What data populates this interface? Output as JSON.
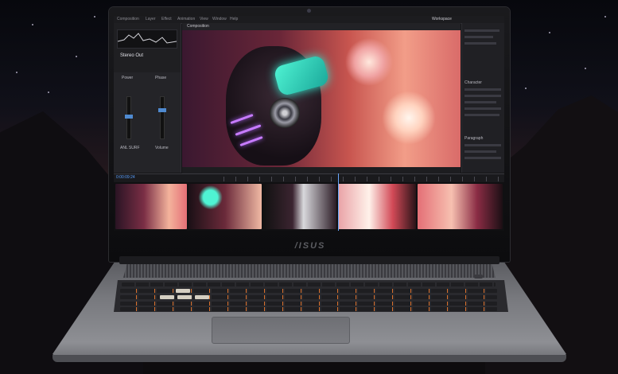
{
  "laptop": {
    "logo_text": "/ISUS"
  },
  "app": {
    "menu_items": [
      "Composition",
      "Layer",
      "Effect",
      "Animation",
      "View",
      "Window",
      "Help"
    ],
    "workspace": "Workspace",
    "left_panel": {
      "preset_name": "Stereo Out",
      "slider_left_label": "Power",
      "slider_right_label": "Phase",
      "bottom_left_label": "ANL SURF",
      "bottom_right_label": "Volume"
    },
    "viewer_tab": "Composition",
    "timecode": "0:00:09:24",
    "right_panel": {
      "section_1": "Character",
      "section_2": "Paragraph"
    }
  }
}
